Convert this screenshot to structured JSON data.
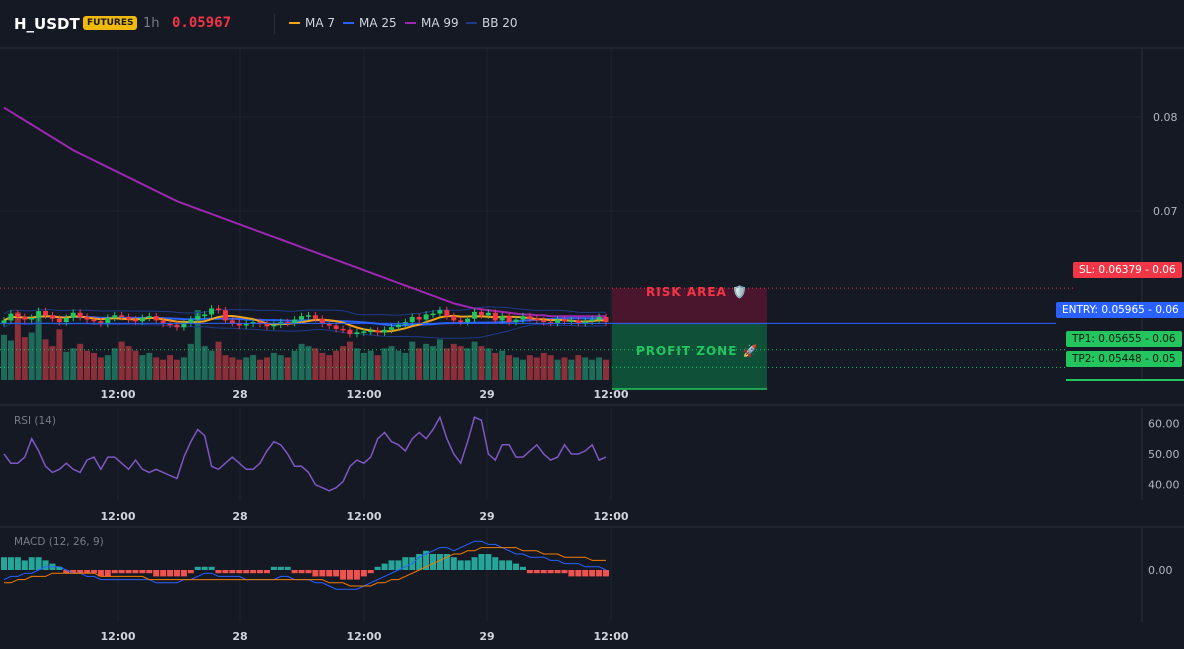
{
  "header": {
    "symbol": "H_USDT",
    "badge": "FUTURES",
    "timeframe": "1h",
    "last_price": "0.05967"
  },
  "legend": [
    {
      "label": "MA 7",
      "color": "#f7a21b"
    },
    {
      "label": "MA 25",
      "color": "#2962ff"
    },
    {
      "label": "MA 99",
      "color": "#9c27b0"
    },
    {
      "label": "BB 20",
      "color": "#1e3a8a"
    }
  ],
  "price_tags": {
    "sl": "SL: 0.06379",
    "sl_axis": "0.06",
    "entry": "ENTRY: 0.05965",
    "entry_axis": "0.06",
    "tp1": "TP1: 0.05655",
    "tp1_axis": "0.06",
    "tp2": "TP2: 0.05448",
    "tp2_axis": "0.05"
  },
  "zones": {
    "risk": "RISK AREA 🛡️",
    "profit": "PROFIT ZONE 🚀"
  },
  "panes": {
    "rsi_title": "RSI (14)",
    "macd_title": "MACD (12, 26, 9)"
  },
  "chart_data": [
    {
      "type": "candlestick",
      "title": "H_USDT 1h",
      "x_tick_labels": [
        "12:00",
        "28",
        "12:00",
        "29",
        "12:00"
      ],
      "y_tick_labels": [
        "0.08",
        "0.07"
      ],
      "ylim": [
        0.053,
        0.092
      ],
      "levels": {
        "sl": 0.06379,
        "entry": 0.05965,
        "tp1": 0.05655,
        "tp2": 0.05448
      },
      "colors": {
        "up": "#22c55e",
        "down": "#f23645",
        "ma7": "#f7a21b",
        "ma25": "#2962ff",
        "ma99": "#9c27b0",
        "bb": "#1e3a8a"
      },
      "close": [
        0.06,
        0.0608,
        0.0604,
        0.0601,
        0.0603,
        0.0611,
        0.0606,
        0.0602,
        0.0598,
        0.0603,
        0.0609,
        0.0604,
        0.0601,
        0.0599,
        0.0596,
        0.0603,
        0.0606,
        0.0604,
        0.0601,
        0.0599,
        0.0603,
        0.0605,
        0.06,
        0.0596,
        0.0595,
        0.0592,
        0.0597,
        0.0601,
        0.0605,
        0.0607,
        0.0614,
        0.0612,
        0.06,
        0.0597,
        0.0594,
        0.0596,
        0.0598,
        0.0596,
        0.0593,
        0.0595,
        0.0598,
        0.0597,
        0.0601,
        0.0605,
        0.0606,
        0.0602,
        0.0596,
        0.0594,
        0.059,
        0.0589,
        0.0584,
        0.0586,
        0.0587,
        0.0588,
        0.0586,
        0.0589,
        0.0592,
        0.0595,
        0.0598,
        0.0604,
        0.0601,
        0.0607,
        0.0608,
        0.0612,
        0.0605,
        0.06,
        0.0598,
        0.0602,
        0.061,
        0.0606,
        0.0609,
        0.06,
        0.0605,
        0.0598,
        0.0601,
        0.0605,
        0.0602,
        0.06,
        0.0598,
        0.0597,
        0.0601,
        0.0599,
        0.06,
        0.0597,
        0.0599,
        0.0601,
        0.0604,
        0.0598
      ],
      "ma99": [
        0.085,
        0.0845,
        0.084,
        0.0835,
        0.083,
        0.0825,
        0.082,
        0.0815,
        0.081,
        0.0805,
        0.08,
        0.0796,
        0.0792,
        0.0788,
        0.0784,
        0.078,
        0.0776,
        0.0772,
        0.0768,
        0.0764,
        0.076,
        0.0756,
        0.0752,
        0.0748,
        0.0744,
        0.074,
        0.0737,
        0.0734,
        0.0731,
        0.0728,
        0.0725,
        0.0722,
        0.0719,
        0.0716,
        0.0713,
        0.071,
        0.0707,
        0.0704,
        0.0701,
        0.0698,
        0.0695,
        0.0692,
        0.0689,
        0.0686,
        0.0683,
        0.068,
        0.0677,
        0.0674,
        0.0671,
        0.0668,
        0.0665,
        0.0662,
        0.0659,
        0.0656,
        0.0653,
        0.065,
        0.0647,
        0.0644,
        0.0641,
        0.0638,
        0.0635,
        0.0632,
        0.0629,
        0.0626,
        0.0623,
        0.062,
        0.0618,
        0.0616,
        0.0614,
        0.0613,
        0.0612,
        0.0611,
        0.061,
        0.0609,
        0.0608,
        0.0607,
        0.0607,
        0.0606,
        0.0606,
        0.0605,
        0.0605,
        0.0605,
        0.0605,
        0.0605,
        0.0605,
        0.0605,
        0.0605,
        0.0605
      ],
      "volume": [
        40,
        35,
        60,
        38,
        42,
        55,
        36,
        30,
        45,
        25,
        28,
        32,
        26,
        24,
        20,
        22,
        28,
        34,
        30,
        26,
        22,
        24,
        20,
        18,
        22,
        18,
        20,
        32,
        62,
        30,
        26,
        34,
        22,
        20,
        18,
        20,
        22,
        18,
        20,
        24,
        22,
        20,
        26,
        32,
        30,
        28,
        24,
        22,
        26,
        30,
        34,
        28,
        24,
        26,
        22,
        28,
        30,
        26,
        24,
        34,
        28,
        32,
        30,
        36,
        28,
        32,
        30,
        28,
        34,
        30,
        28,
        24,
        26,
        22,
        20,
        18,
        22,
        20,
        24,
        22,
        18,
        20,
        18,
        22,
        20,
        18,
        20,
        18
      ]
    },
    {
      "type": "line",
      "title": "RSI (14)",
      "y_tick_labels": [
        "60.00",
        "50.00",
        "40.00"
      ],
      "ylim": [
        35,
        65
      ],
      "series": [
        {
          "name": "RSI (14)",
          "color": "#7e57c2",
          "values": [
            50,
            47,
            47,
            49,
            55,
            51,
            46,
            44,
            45,
            47,
            45,
            44,
            48,
            49,
            45,
            49,
            49,
            47,
            45,
            48,
            45,
            44,
            45,
            44,
            43,
            42,
            49,
            54,
            58,
            56,
            46,
            45,
            47,
            49,
            47,
            45,
            45,
            47,
            51,
            54,
            53,
            50,
            46,
            46,
            44,
            40,
            39,
            38,
            39,
            41,
            46,
            48,
            47,
            49,
            55,
            57,
            54,
            53,
            51,
            55,
            57,
            55,
            58,
            62,
            55,
            50,
            47,
            54,
            62,
            61,
            50,
            48,
            53,
            53,
            49,
            49,
            51,
            53,
            50,
            48,
            49,
            53,
            50,
            50,
            51,
            53,
            48,
            49
          ]
        }
      ]
    },
    {
      "type": "bar",
      "title": "MACD (12, 26, 9)",
      "y_tick_labels": [
        "0.00"
      ],
      "series": [
        {
          "name": "histogram",
          "color_up": "#26a69a",
          "color_down": "#ef5350",
          "values": [
            4,
            4,
            4,
            3,
            4,
            4,
            3,
            2,
            1,
            -1,
            -1,
            -1,
            -1,
            -1,
            -2,
            -2,
            -1,
            -1,
            -1,
            -1,
            -1,
            -1,
            -2,
            -2,
            -2,
            -2,
            -2,
            -1,
            1,
            1,
            1,
            -1,
            -1,
            -1,
            -1,
            -1,
            -1,
            -1,
            -1,
            1,
            1,
            1,
            -1,
            -1,
            -1,
            -2,
            -2,
            -2,
            -2,
            -3,
            -3,
            -3,
            -2,
            -1,
            1,
            2,
            3,
            3,
            4,
            4,
            5,
            6,
            5,
            5,
            5,
            4,
            3,
            3,
            4,
            5,
            5,
            4,
            3,
            3,
            2,
            1,
            -1,
            -1,
            -1,
            -1,
            -1,
            -1,
            -2,
            -2,
            -2,
            -2,
            -2,
            -2
          ]
        },
        {
          "name": "MACD",
          "color": "#2962ff",
          "values": [
            -3,
            -2,
            -2,
            -1,
            -1,
            0,
            1,
            1,
            1,
            0,
            -1,
            -1,
            -2,
            -2,
            -3,
            -3,
            -3,
            -3,
            -3,
            -3,
            -3,
            -3,
            -4,
            -4,
            -4,
            -4,
            -3,
            -3,
            -2,
            -1,
            -1,
            -2,
            -2,
            -2,
            -2,
            -3,
            -3,
            -3,
            -3,
            -3,
            -2,
            -2,
            -3,
            -3,
            -3,
            -4,
            -4,
            -5,
            -6,
            -6,
            -6,
            -6,
            -5,
            -4,
            -3,
            -2,
            -1,
            0,
            1,
            2,
            4,
            5,
            6,
            7,
            7,
            6,
            7,
            8,
            9,
            9,
            8,
            8,
            7,
            6,
            5,
            5,
            4,
            4,
            4,
            3,
            3,
            2,
            2,
            2,
            1,
            1,
            1,
            0
          ]
        },
        {
          "name": "Signal",
          "color": "#f57c00",
          "values": [
            -4,
            -4,
            -3,
            -3,
            -2,
            -2,
            -2,
            -1,
            -1,
            -1,
            -1,
            -1,
            -1,
            -1,
            -2,
            -2,
            -2,
            -2,
            -2,
            -2,
            -2,
            -3,
            -3,
            -3,
            -3,
            -3,
            -3,
            -3,
            -3,
            -3,
            -3,
            -3,
            -3,
            -3,
            -3,
            -3,
            -3,
            -3,
            -3,
            -3,
            -3,
            -3,
            -3,
            -3,
            -3,
            -3,
            -3,
            -4,
            -4,
            -4,
            -5,
            -5,
            -5,
            -5,
            -4,
            -4,
            -3,
            -3,
            -2,
            -1,
            0,
            1,
            2,
            3,
            4,
            5,
            5,
            6,
            6,
            7,
            7,
            7,
            7,
            7,
            7,
            6,
            6,
            6,
            5,
            5,
            5,
            4,
            4,
            4,
            4,
            3,
            3,
            3
          ]
        }
      ]
    }
  ]
}
